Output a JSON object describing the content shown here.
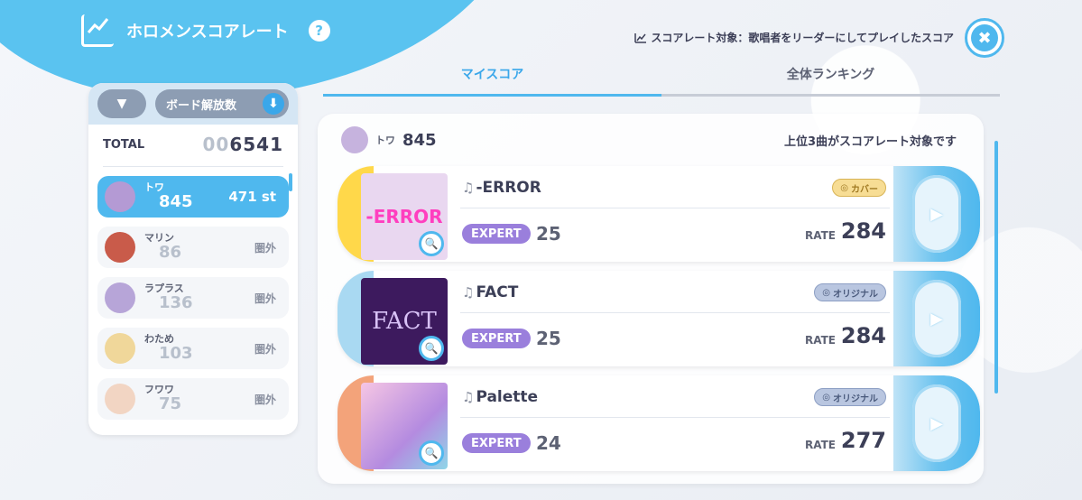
{
  "header": {
    "title": "ホロメンスコアレート",
    "help_icon": "?",
    "target_note": "スコアレート対象：歌唱者をリーダーにしてプレイしたスコア",
    "close_label": "✖"
  },
  "left_panel": {
    "filter_icon": "▼",
    "sort_label": "ボード解放数",
    "sort_arrow": "⬇",
    "total_label": "TOTAL",
    "total_prefix": "00",
    "total_value": "6541",
    "members": [
      {
        "name": "トワ",
        "score": "845",
        "rank": "471 st",
        "active": true
      },
      {
        "name": "マリン",
        "score": "86",
        "rank": "圏外",
        "active": false
      },
      {
        "name": "ラプラス",
        "score": "136",
        "rank": "圏外",
        "active": false
      },
      {
        "name": "わため",
        "score": "103",
        "rank": "圏外",
        "active": false
      },
      {
        "name": "フワワ",
        "score": "75",
        "rank": "圏外",
        "active": false
      }
    ]
  },
  "tabs": [
    {
      "label": "マイスコア",
      "active": true
    },
    {
      "label": "全体ランキング",
      "active": false
    }
  ],
  "main": {
    "leader_name": "トワ",
    "leader_score": "845",
    "note": "上位3曲がスコアレート対象です",
    "songs": [
      {
        "title": "-ERROR",
        "jacket_text": "-ERROR",
        "difficulty": "EXPERT",
        "level": "25",
        "type": "カバー",
        "rate_label": "RATE",
        "rate": "284",
        "stripe_color": "#ffd84a",
        "jacket_color": "#e9d7f0",
        "type_kind": "cover"
      },
      {
        "title": "FACT",
        "jacket_text": "FACT",
        "difficulty": "EXPERT",
        "level": "25",
        "type": "オリジナル",
        "rate_label": "RATE",
        "rate": "284",
        "stripe_color": "#a9d9f2",
        "jacket_color": "#3d1a5e",
        "type_kind": "orig"
      },
      {
        "title": "Palette",
        "jacket_text": "",
        "difficulty": "EXPERT",
        "level": "24",
        "type": "オリジナル",
        "rate_label": "RATE",
        "rate": "277",
        "stripe_color": "#f3a37a",
        "jacket_color": "#d9a6e4",
        "type_kind": "orig"
      }
    ]
  },
  "colors": {
    "accent": "#4fb8ee",
    "expert": "#9a7fdc"
  }
}
